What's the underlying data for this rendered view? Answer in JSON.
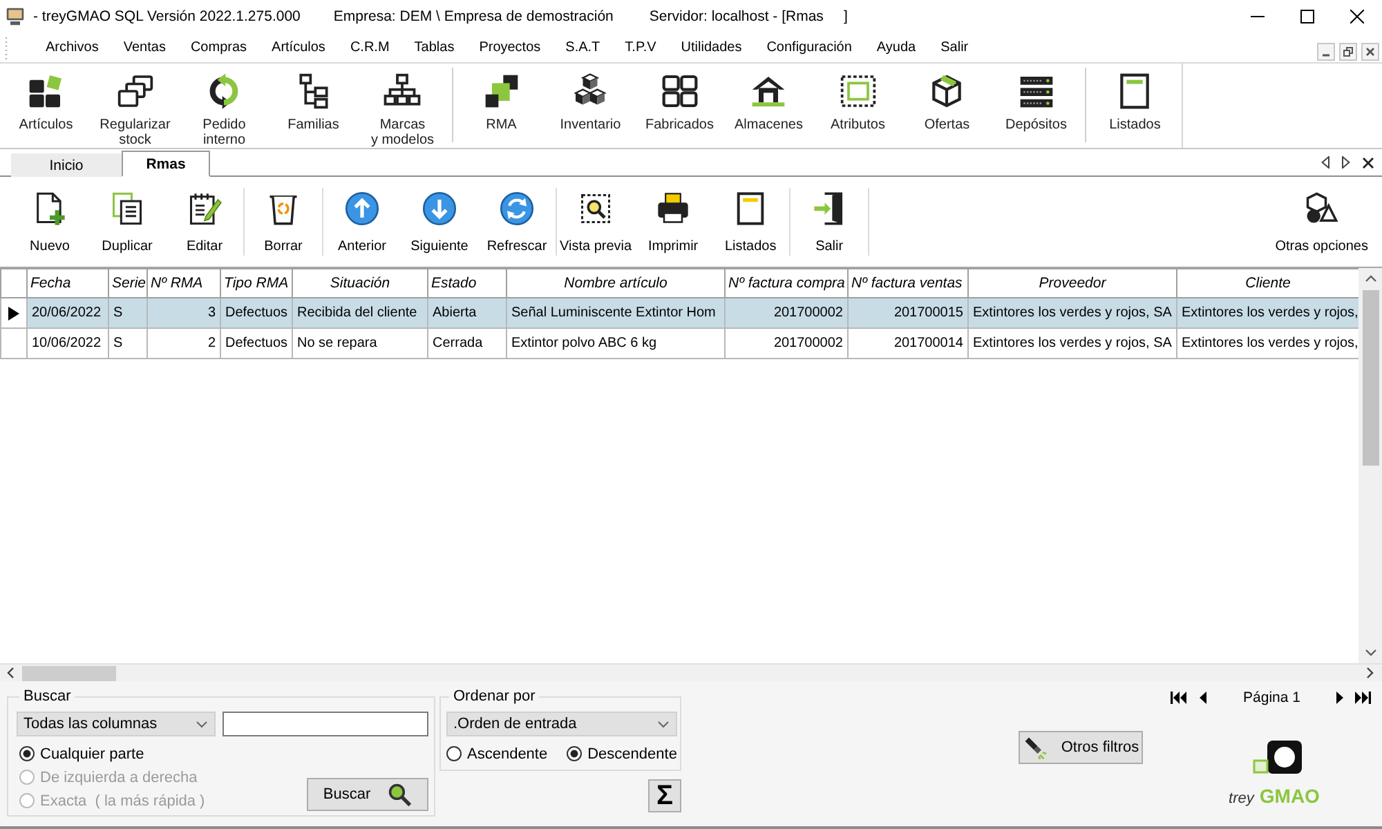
{
  "window": {
    "title": "- treyGMAO SQL Versión 2022.1.275.000",
    "company": "Empresa: DEM \\ Empresa de demostración",
    "server": "Servidor: localhost - [Rmas     ]"
  },
  "menu": [
    "Archivos",
    "Ventas",
    "Compras",
    "Artículos",
    "C.R.M",
    "Tablas",
    "Proyectos",
    "S.A.T",
    "T.P.V",
    "Utilidades",
    "Configuración",
    "Ayuda",
    "Salir"
  ],
  "ribbon": {
    "groups": [
      [
        "Artículos",
        "Regularizar\nstock",
        "Pedido\ninterno",
        "Familias",
        "Marcas\ny modelos"
      ],
      [
        "RMA",
        "Inventario",
        "Fabricados",
        "Almacenes",
        "Atributos",
        "Ofertas",
        "Depósitos"
      ],
      [
        "Listados"
      ]
    ]
  },
  "tabs": [
    {
      "label": "Inicio",
      "selected": false
    },
    {
      "label": "Rmas",
      "selected": true
    }
  ],
  "toolbar": {
    "groups": [
      [
        "Nuevo",
        "Duplicar",
        "Editar"
      ],
      [
        "Borrar"
      ],
      [
        "Anterior",
        "Siguiente",
        "Refrescar"
      ],
      [
        "Vista previa",
        "Imprimir",
        "Listados"
      ],
      [
        "Salir"
      ]
    ],
    "more": "Otras opciones"
  },
  "table": {
    "columns": [
      "Fecha",
      "Serie",
      "Nº RMA",
      "Tipo RMA",
      "Situación",
      "Estado",
      "Nombre artículo",
      "Nº factura compra",
      "Nº factura ventas",
      "Proveedor",
      "Cliente"
    ],
    "rows": [
      {
        "selected": true,
        "cells": [
          "20/06/2022",
          "S",
          "3",
          "Defectuos",
          "Recibida del cliente",
          "Abierta",
          "Señal Luminiscente Extintor Hom",
          "201700002",
          "201700015",
          "Extintores los verdes y rojos, SA",
          "Extintores los verdes y rojos,"
        ]
      },
      {
        "selected": false,
        "cells": [
          "10/06/2022",
          "S",
          "2",
          "Defectuos",
          "No se repara",
          "Cerrada",
          "Extintor polvo ABC 6 kg",
          "201700002",
          "201700014",
          "Extintores los verdes y rojos, SA",
          "Extintores los verdes y rojos,"
        ]
      }
    ]
  },
  "search": {
    "title": "Buscar",
    "column": "Todas las columnas",
    "modes": [
      {
        "label": "Cualquier parte",
        "selected": true,
        "disabled": false
      },
      {
        "label": "De izquierda a derecha",
        "selected": false,
        "disabled": true
      },
      {
        "label": "Exacta  ( la más rápida )",
        "selected": false,
        "disabled": true
      }
    ],
    "button": "Buscar"
  },
  "sort": {
    "title": "Ordenar por",
    "field": ".Orden de entrada",
    "directions": [
      {
        "label": "Ascendente",
        "selected": false
      },
      {
        "label": "Descendente",
        "selected": true
      }
    ]
  },
  "totals_button": "Σ",
  "pager": {
    "page": "Página 1"
  },
  "filters_button": "Otros filtros",
  "logo": {
    "prefix": "trey",
    "name": "GMAO"
  }
}
